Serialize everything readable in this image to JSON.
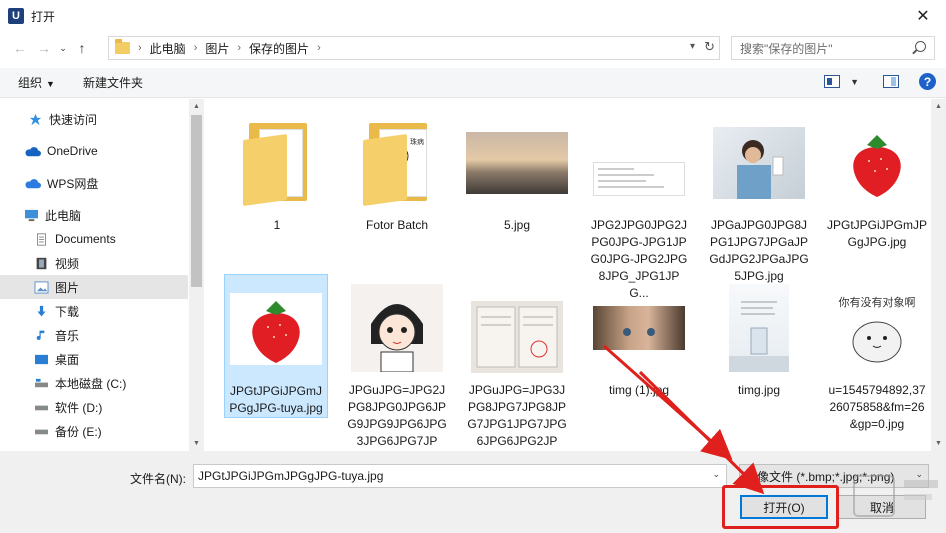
{
  "window": {
    "title": "打开",
    "app_icon_letter": "U",
    "close_icon": "close-icon"
  },
  "nav": {
    "back_icon": "arrow-left-icon",
    "forward_icon": "arrow-right-icon",
    "recent_icon": "chevron-down-icon",
    "up_icon": "arrow-up-icon"
  },
  "address": {
    "crumbs": [
      "此电脑",
      "图片",
      "保存的图片"
    ]
  },
  "search": {
    "placeholder": "搜索\"保存的图片\""
  },
  "toolbar": {
    "organize_label": "组织",
    "new_folder_label": "新建文件夹"
  },
  "sidebar": {
    "items": [
      {
        "label": "快速访问",
        "icon": "star-icon"
      },
      {
        "label": "OneDrive",
        "icon": "cloud-icon"
      },
      {
        "label": "WPS网盘",
        "icon": "cloud-icon"
      },
      {
        "label": "此电脑",
        "icon": "computer-icon"
      },
      {
        "label": "Documents",
        "icon": "document-icon"
      },
      {
        "label": "视频",
        "icon": "film-icon"
      },
      {
        "label": "图片",
        "icon": "picture-icon"
      },
      {
        "label": "下载",
        "icon": "download-icon"
      },
      {
        "label": "音乐",
        "icon": "music-icon"
      },
      {
        "label": "桌面",
        "icon": "desktop-icon"
      },
      {
        "label": "本地磁盘 (C:)",
        "icon": "drive-icon"
      },
      {
        "label": "软件 (D:)",
        "icon": "drive-icon"
      },
      {
        "label": "备份 (E:)",
        "icon": "drive-icon"
      }
    ],
    "selected_index": 6
  },
  "files": [
    {
      "name": "1",
      "kind": "folder"
    },
    {
      "name": "Fotor Batch",
      "kind": "folder",
      "thumb_text": "珠病"
    },
    {
      "name": "5.jpg",
      "kind": "image"
    },
    {
      "name": "JPG2JPG0JPG2JPG0JPG-JPG1JPG0JPG-JPG2JPG8JPG_JPG1JPG...",
      "kind": "image"
    },
    {
      "name": "JPGaJPG0JPG8JPG1JPG7JPGaJPGdJPG2JPGaJPG5JPG.jpg",
      "kind": "image"
    },
    {
      "name": "JPGtJPGiJPGmJPGgJPG.jpg",
      "kind": "image"
    },
    {
      "name": "JPGtJPGiJPGmJPGgJPG-tuya.jpg",
      "kind": "image"
    },
    {
      "name": "JPGuJPG=JPG2JPG8JPG0JPG6JPG9JPG9JPG6JPG3JPG6JPG7JPG...",
      "kind": "image"
    },
    {
      "name": "JPGuJPG=JPG3JPG8JPG7JPG8JPG7JPG1JPG7JPG6JPG6JPG2JPG...",
      "kind": "image"
    },
    {
      "name": "timg (1).jpg",
      "kind": "image"
    },
    {
      "name": "timg.jpg",
      "kind": "image"
    },
    {
      "name": "u=1545794892,3726075858&fm=26&gp=0.jpg",
      "kind": "image",
      "thumb_text": "你有没有对象啊"
    }
  ],
  "selected_file_index": 6,
  "footer": {
    "filename_label": "文件名(N):",
    "filename_value": "JPGtJPGiJPGmJPGgJPG-tuya.jpg",
    "filter_value": "图像文件 (*.bmp;*.jpg;*.png)",
    "open_label": "打开(O)",
    "cancel_label": "取消"
  },
  "colors": {
    "accent": "#0078d7",
    "selection": "#cce8ff",
    "annotation_red": "#e0201c",
    "folder_yellow": "#f5cf6a"
  }
}
